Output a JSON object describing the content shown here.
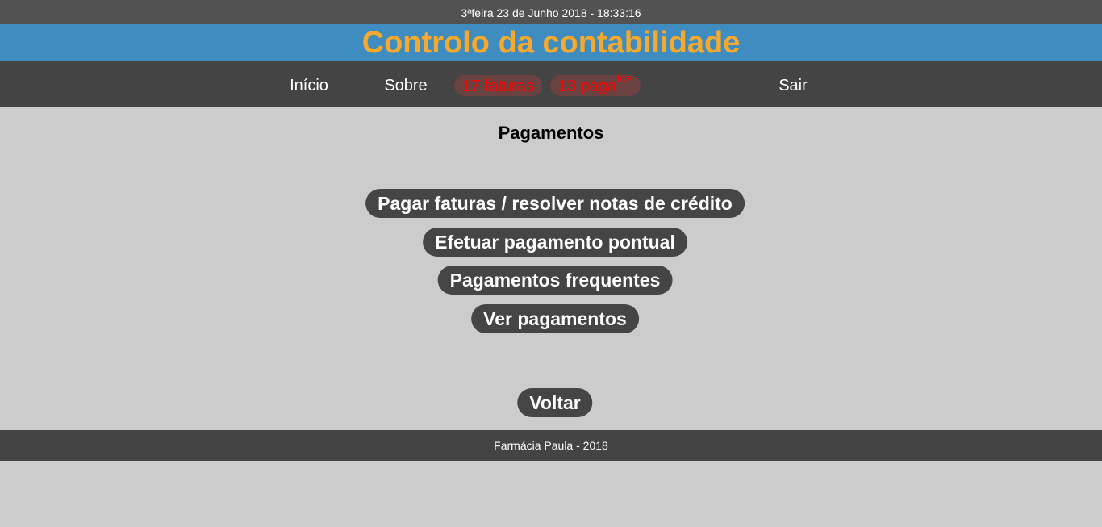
{
  "header": {
    "datetime": "3ªfeira 23 de Junho 2018 - 18:33:16",
    "title": "Controlo da contabilidade"
  },
  "nav": {
    "inicio": "Início",
    "sobre": "Sobre",
    "faturas_badge": "17 faturas",
    "pagamentos_badge_main": "13 paga",
    "pagamentos_badge_sup": "tos",
    "sair": "Sair"
  },
  "main": {
    "title": "Pagamentos",
    "buttons": [
      "Pagar faturas / resolver notas de crédito",
      "Efetuar pagamento pontual",
      "Pagamentos frequentes",
      "Ver pagamentos"
    ],
    "back": "Voltar"
  },
  "footer": {
    "text": "Farmácia Paula - 2018"
  },
  "colors": {
    "title_text": "#f6a92c",
    "title_bar": "#3f8cc0",
    "nav_bar": "#444444",
    "badge_text": "#ff0000",
    "background": "#cccccc"
  }
}
